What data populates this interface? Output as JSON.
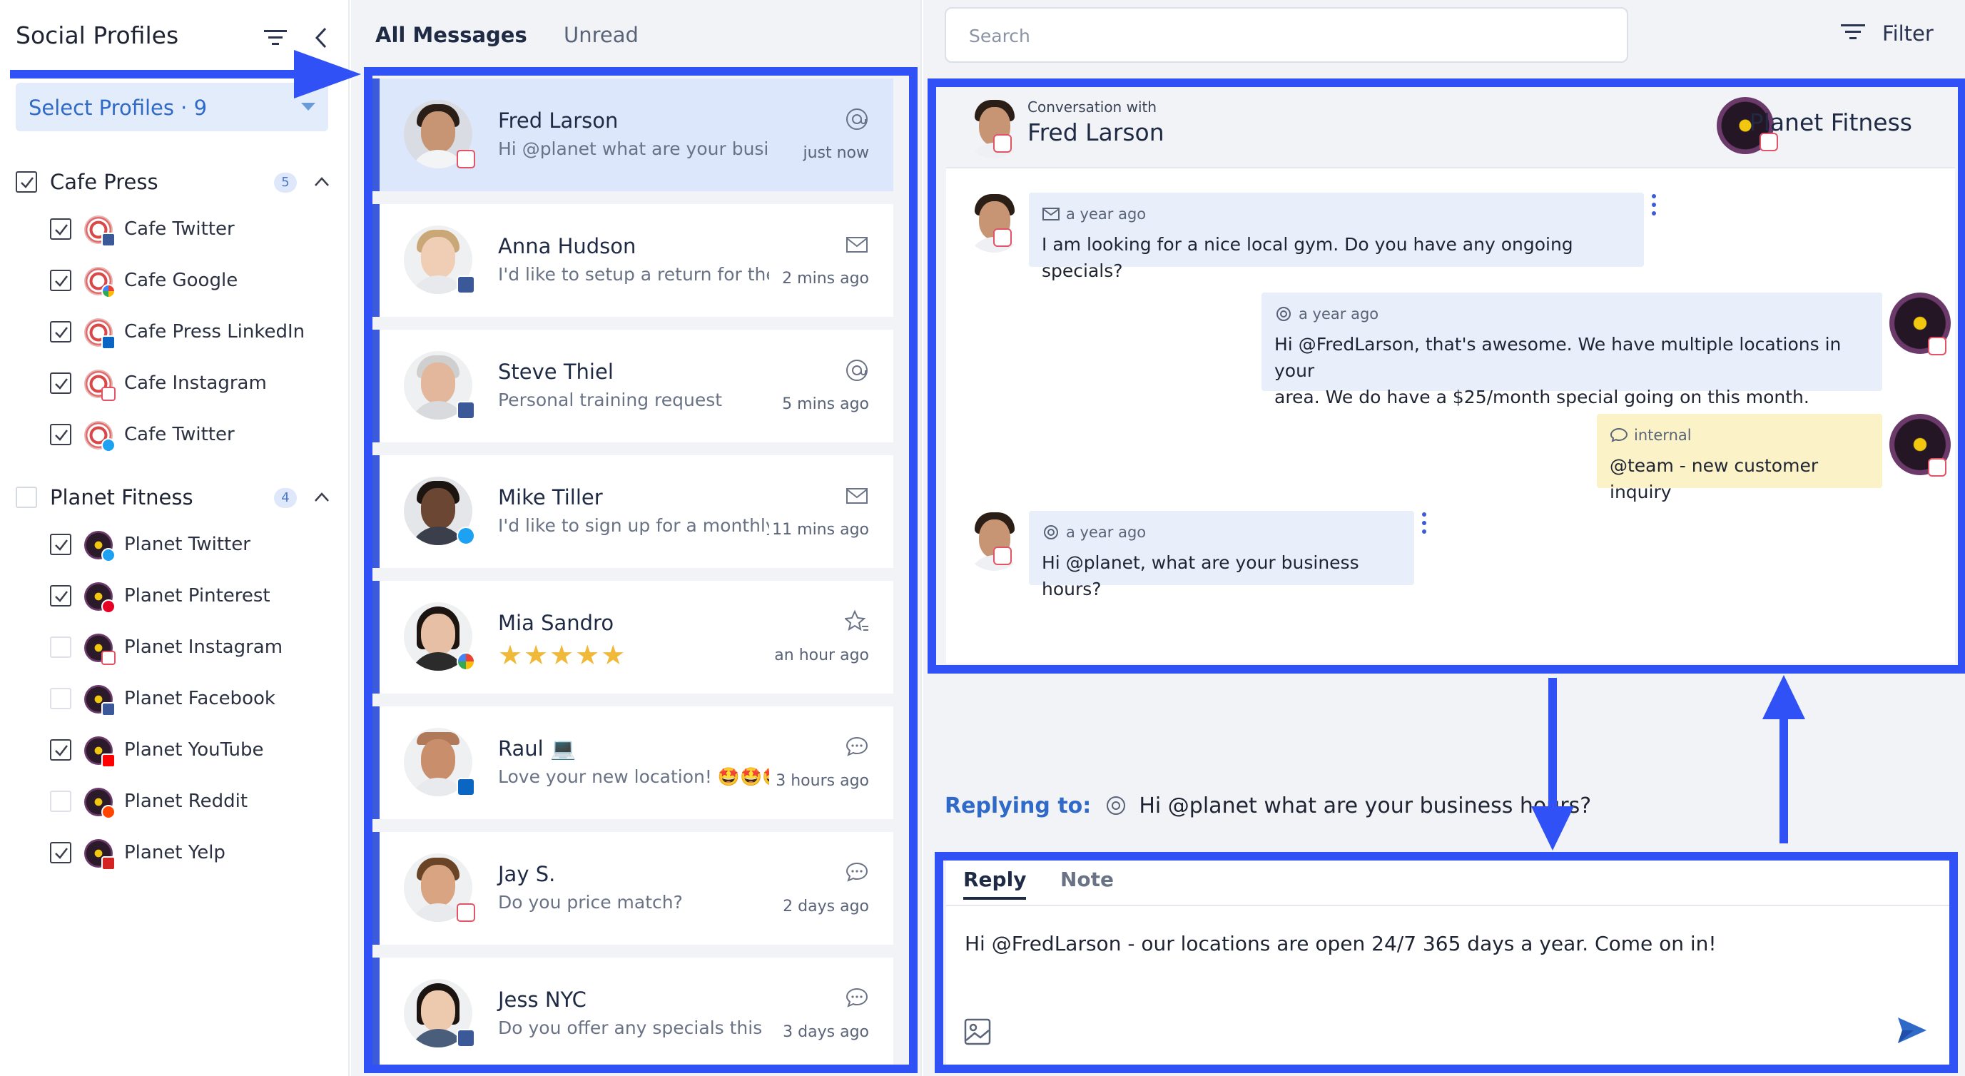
{
  "left_panel": {
    "title": "Social Profiles",
    "select_profiles": "Select Profiles · 9",
    "groups": [
      {
        "name": "Cafe Press",
        "badge": "5",
        "checked": true,
        "profiles": [
          {
            "label": "Cafe Twitter",
            "checked": true,
            "network": "facebook"
          },
          {
            "label": "Cafe Google",
            "checked": true,
            "network": "google"
          },
          {
            "label": "Cafe Press LinkedIn",
            "checked": true,
            "network": "linkedin"
          },
          {
            "label": "Cafe Instagram",
            "checked": true,
            "network": "instagram"
          },
          {
            "label": "Cafe Twitter",
            "checked": true,
            "network": "twitter"
          }
        ]
      },
      {
        "name": "Planet Fitness",
        "badge": "4",
        "checked": false,
        "profiles": [
          {
            "label": "Planet Twitter",
            "checked": true,
            "network": "twitter"
          },
          {
            "label": "Planet Pinterest",
            "checked": true,
            "network": "pinterest"
          },
          {
            "label": "Planet Instagram",
            "checked": false,
            "network": "instagram"
          },
          {
            "label": "Planet Facebook",
            "checked": false,
            "network": "facebook"
          },
          {
            "label": "Planet YouTube",
            "checked": true,
            "network": "youtube"
          },
          {
            "label": "Planet Reddit",
            "checked": false,
            "network": "reddit"
          },
          {
            "label": "Planet Yelp",
            "checked": true,
            "network": "yelp"
          }
        ]
      }
    ]
  },
  "middle_panel": {
    "tabs": [
      "All Messages",
      "Unread"
    ],
    "messages": [
      {
        "name": "Fred Larson",
        "preview": "Hi @planet what are your busi...",
        "time": "just now",
        "icon": "mention-icon",
        "network": "instagram",
        "selected": true
      },
      {
        "name": "Anna Hudson",
        "preview": "I'd like to setup a return for the...",
        "time": "2 mins ago",
        "icon": "mail-icon",
        "network": "facebook",
        "selected": false
      },
      {
        "name": "Steve Thiel",
        "preview": "Personal training request",
        "time": "5 mins ago",
        "icon": "mention-icon",
        "network": "facebook",
        "selected": false
      },
      {
        "name": "Mike Tiller",
        "preview": "I'd like to sign up for a monthly...",
        "time": "11 mins ago",
        "icon": "mail-icon",
        "network": "twitter",
        "selected": false
      },
      {
        "name": "Mia Sandro",
        "preview": "★★★★★",
        "time": "an hour ago",
        "icon": "review-star-icon",
        "network": "google",
        "selected": false,
        "rating": 5
      },
      {
        "name": "Raul 💻",
        "preview": "Love your new location! 🤩🤩🤩",
        "time": "3 hours ago",
        "icon": "chat-icon",
        "network": "linkedin",
        "selected": false
      },
      {
        "name": "Jay S.",
        "preview": "Do you price match?",
        "time": "2 days ago",
        "icon": "chat-icon",
        "network": "instagram",
        "selected": false
      },
      {
        "name": "Jess NYC",
        "preview": "Do you offer any specials this ...",
        "time": "3 days ago",
        "icon": "chat-icon",
        "network": "facebook",
        "selected": false
      }
    ]
  },
  "right_panel": {
    "search_placeholder": "Search",
    "filter_label": "Filter",
    "conversation": {
      "subtitle": "Conversation with",
      "contact_name": "Fred Larson",
      "brand_name": "Planet Fitness",
      "messages": [
        {
          "meta": "a year ago",
          "text": "I am looking for a nice local gym. Do you have any ongoing specials?",
          "side": "left",
          "type": "mail"
        },
        {
          "meta": "a year ago",
          "text_lines": [
            "Hi @FredLarson, that's awesome. We have multiple locations in your",
            "area. We do have a $25/month special going on this month."
          ],
          "side": "right",
          "type": "mention"
        },
        {
          "meta": "internal",
          "text": "@team - new customer inquiry",
          "side": "right",
          "type": "internal"
        },
        {
          "meta": "a year ago",
          "text": "Hi @planet, what are your business hours?",
          "side": "left",
          "type": "mention"
        }
      ]
    },
    "replying": {
      "label": "Replying to:",
      "text": "Hi @planet what are your business hours?"
    },
    "reply_box": {
      "tabs": [
        "Reply",
        "Note"
      ],
      "text": "Hi @FredLarson - our locations are open 24/7 365 days a year. Come on in!"
    }
  },
  "colors": {
    "annotation_blue": "#2f51f5",
    "accent": "#2f6ac8",
    "selected_row": "#dce7fb",
    "internal_note": "#fbf2c7"
  }
}
